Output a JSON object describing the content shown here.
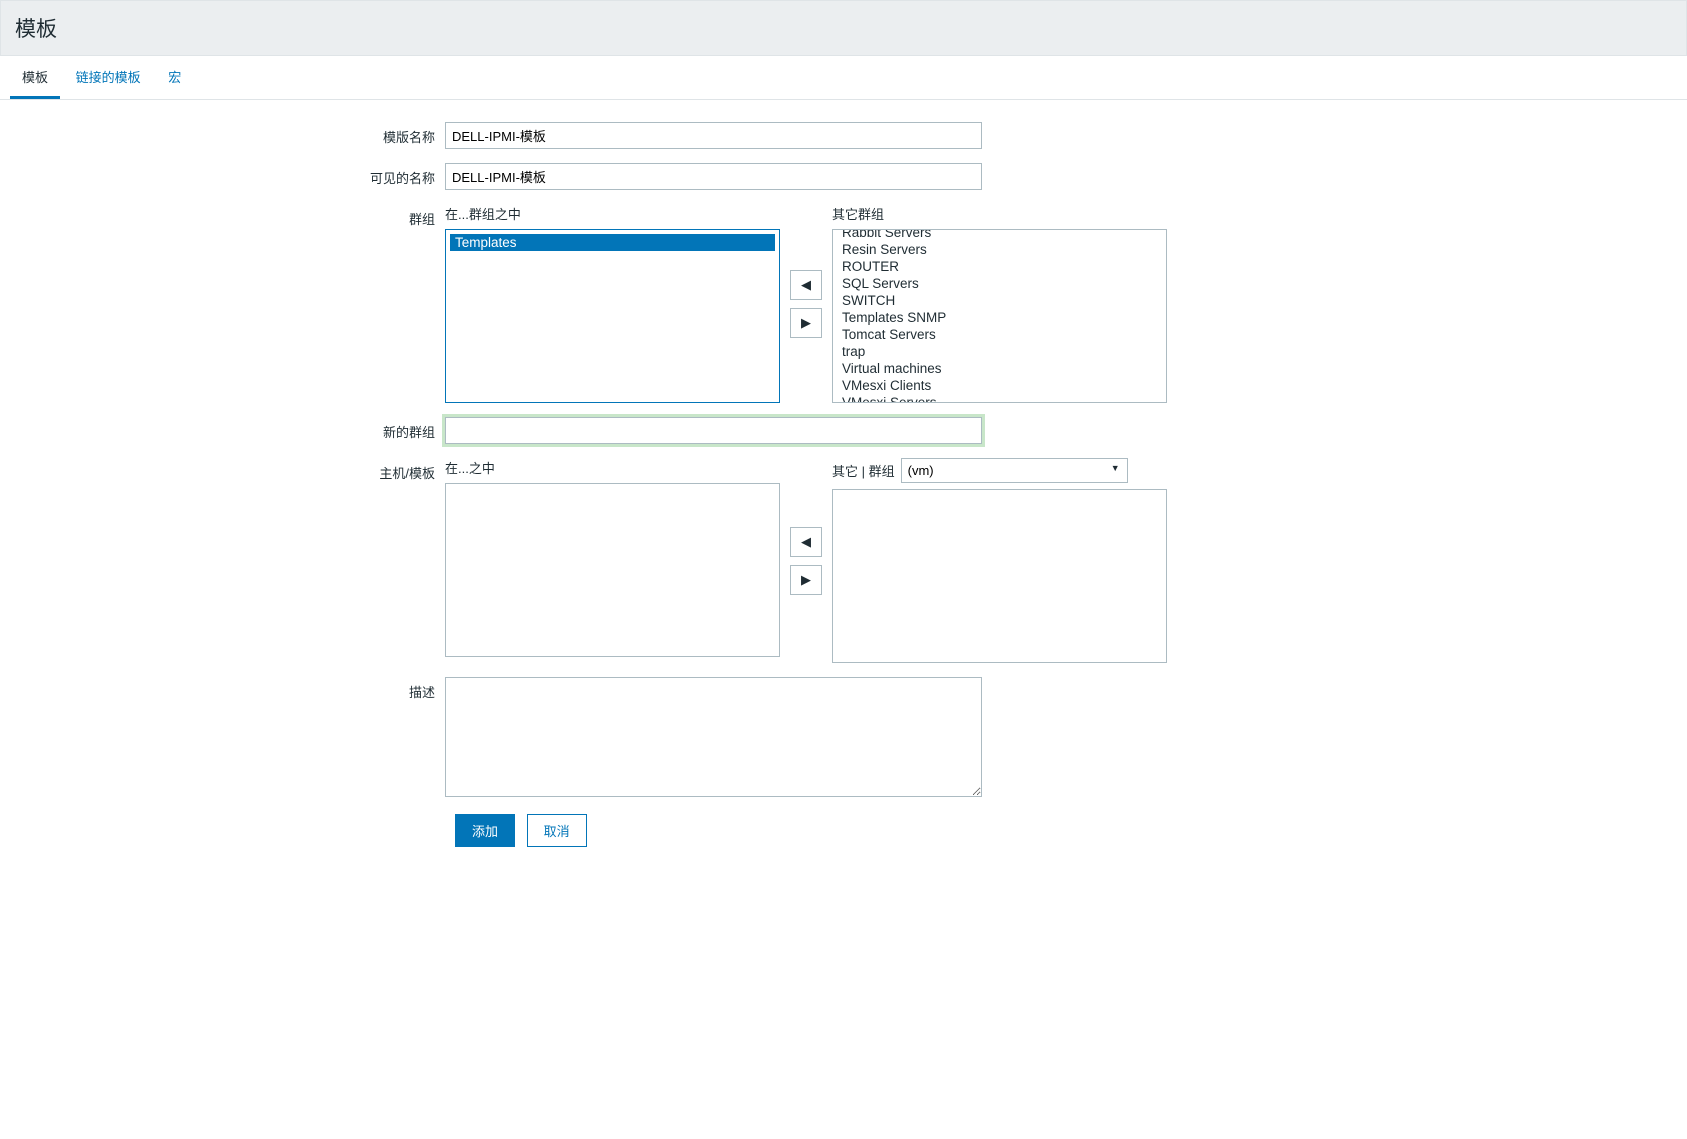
{
  "header": {
    "title": "模板"
  },
  "tabs": [
    {
      "label": "模板",
      "active": true
    },
    {
      "label": "链接的模板",
      "active": false
    },
    {
      "label": "宏",
      "active": false
    }
  ],
  "form": {
    "template_name_label": "模版名称",
    "template_name_value": "DELL-IPMI-模板",
    "visible_name_label": "可见的名称",
    "visible_name_value": "DELL-IPMI-模板",
    "groups_label": "群组",
    "in_groups_label": "在...群组之中",
    "other_groups_label": "其它群组",
    "in_groups_items": [
      {
        "label": "Templates",
        "selected": true
      }
    ],
    "other_groups_items": [
      {
        "label": "Rabbit Servers"
      },
      {
        "label": "Resin Servers"
      },
      {
        "label": "ROUTER"
      },
      {
        "label": "SQL Servers"
      },
      {
        "label": "SWITCH"
      },
      {
        "label": "Templates SNMP"
      },
      {
        "label": "Tomcat Servers"
      },
      {
        "label": "trap"
      },
      {
        "label": "Virtual machines"
      },
      {
        "label": "VMesxi Clients"
      },
      {
        "label": "VMesxi Servers"
      }
    ],
    "new_group_label": "新的群组",
    "new_group_value": "",
    "hosts_templates_label": "主机/模板",
    "in_label": "在...之中",
    "other_hosts_label": "其它 | 群组",
    "group_selector_value": "(vm)",
    "in_hosts_items": [],
    "other_hosts_items": [],
    "description_label": "描述",
    "description_value": ""
  },
  "buttons": {
    "add": "添加",
    "cancel": "取消"
  },
  "icons": {
    "left": "◀",
    "right": "▶"
  }
}
